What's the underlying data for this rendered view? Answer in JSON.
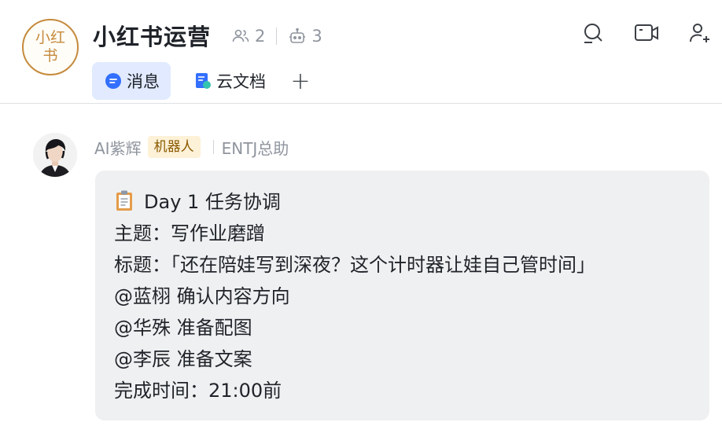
{
  "group": {
    "avatar_text_line1": "小红",
    "avatar_text_line2": "书",
    "title": "小红书运营",
    "member_count": "2",
    "bot_count": "3"
  },
  "tabs": [
    {
      "label": "消息",
      "active": true,
      "icon": "message-bubble-icon"
    },
    {
      "label": "云文档",
      "active": false,
      "icon": "doc-icon"
    }
  ],
  "tab_add_label": "+",
  "message": {
    "sender_name": "AI紫辉",
    "badge": "机器人",
    "sender_title": "ENTJ总助",
    "lines": [
      "Day 1 任务协调",
      "主题：写作业磨蹭",
      "标题：「还在陪娃写到深夜？这个计时器让娃自己管时间」",
      "@蓝栩 确认内容方向",
      "@华殊 准备配图",
      "@李辰 准备文案",
      "完成时间：21:00前"
    ],
    "first_line_icon": "clipboard-icon"
  },
  "colors": {
    "accent": "#3370ff",
    "tab_active_bg": "#e1eaff",
    "bubble_bg": "#eff0f1",
    "badge_bg": "#fdf1d7",
    "avatar_border": "#c58a3c"
  }
}
